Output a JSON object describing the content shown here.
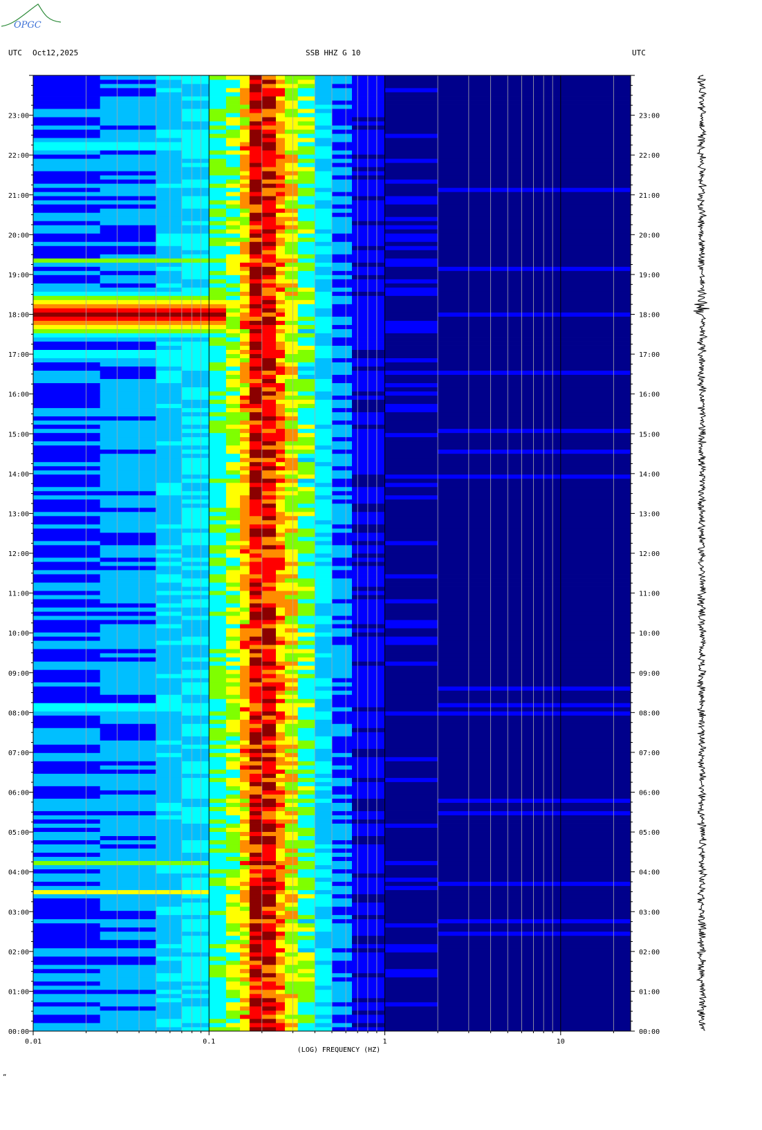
{
  "header": {
    "left_tz": "UTC",
    "date": "Oct12,2025",
    "station": "SSB HHZ G 10",
    "right_tz": "UTC"
  },
  "logo": {
    "text": "OPGC",
    "color": "#2e8b3a"
  },
  "footer": {
    "mark": "“"
  },
  "chart_data": {
    "type": "heatmap",
    "title": "SSB HHZ G 10",
    "xlabel": "(LOG) FREQUENCY (HZ)",
    "ylabel": "UTC",
    "x_scale": "log",
    "xlim": [
      0.01,
      25
    ],
    "x_ticks": [
      0.01,
      0.1,
      1,
      10
    ],
    "x_tick_labels": [
      "0.01",
      "0.1",
      "1",
      "10"
    ],
    "ylim": [
      "00:00",
      "24:00"
    ],
    "y_tick_labels": [
      "00:00",
      "01:00",
      "02:00",
      "03:00",
      "04:00",
      "05:00",
      "06:00",
      "07:00",
      "08:00",
      "09:00",
      "10:00",
      "11:00",
      "12:00",
      "13:00",
      "14:00",
      "15:00",
      "16:00",
      "17:00",
      "18:00",
      "19:00",
      "20:00",
      "21:00",
      "22:00",
      "23:00"
    ],
    "microseism_peak_hz": [
      0.15,
      0.25
    ],
    "events": [
      {
        "time": "18:00",
        "fmax_hz": 0.1,
        "level": "high"
      },
      {
        "time": "22:13",
        "fmax_hz": 0.1,
        "level": "medium"
      },
      {
        "time": "19:20",
        "fmax_hz": 0.1,
        "level": "medium"
      },
      {
        "time": "08:09",
        "fmax_hz": 0.1,
        "level": "medium"
      },
      {
        "time": "04:15",
        "fmax_hz": 0.07,
        "level": "medium"
      },
      {
        "time": "03:30",
        "fmax_hz": 0.07,
        "level": "medium"
      },
      {
        "time": "17:00",
        "fmax_hz": 0.1,
        "level": "medium"
      }
    ],
    "colorscale": [
      "#00008b",
      "#0000ff",
      "#00bfff",
      "#00ffff",
      "#7fff00",
      "#ffff00",
      "#ff8c00",
      "#ff0000",
      "#8b0000"
    ],
    "seismogram_events": [
      {
        "time": "18:10",
        "amplitude": "large"
      },
      {
        "time": "17:25",
        "amplitude": "medium"
      }
    ]
  }
}
